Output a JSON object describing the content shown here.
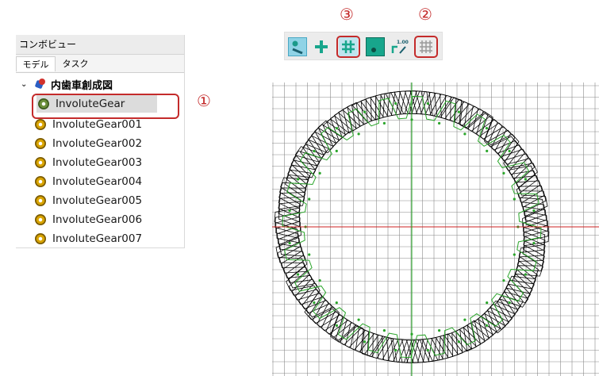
{
  "combo_view": {
    "title": "コンボビュー",
    "tabs": [
      {
        "label": "モデル",
        "active": true
      },
      {
        "label": "タスク",
        "active": false
      }
    ],
    "document": {
      "name": "内歯車創成図",
      "items": [
        {
          "label": "InvoluteGear",
          "selected": true
        },
        {
          "label": "InvoluteGear001",
          "selected": false
        },
        {
          "label": "InvoluteGear002",
          "selected": false
        },
        {
          "label": "InvoluteGear003",
          "selected": false
        },
        {
          "label": "InvoluteGear004",
          "selected": false
        },
        {
          "label": "InvoluteGear005",
          "selected": false
        },
        {
          "label": "InvoluteGear006",
          "selected": false
        },
        {
          "label": "InvoluteGear007",
          "selected": false
        }
      ]
    }
  },
  "toolbar": {
    "buttons": [
      {
        "icon": "snap-lock-icon"
      },
      {
        "icon": "snap-endpoint-icon"
      },
      {
        "icon": "snap-grid-icon"
      },
      {
        "icon": "working-plane-icon"
      },
      {
        "icon": "dimension-snap-icon",
        "text": "1.00"
      },
      {
        "icon": "toggle-grid-icon"
      }
    ]
  },
  "annotations": {
    "marker_1": "①",
    "marker_2": "②",
    "marker_3": "③",
    "color": "#c42b2b"
  },
  "viewport": {
    "grid_color": "#8a8a8a",
    "x_axis_color": "#cc2222",
    "y_axis_color": "#22aa22",
    "gear_color": "#000000",
    "sketch_color": "#2aa52a"
  }
}
